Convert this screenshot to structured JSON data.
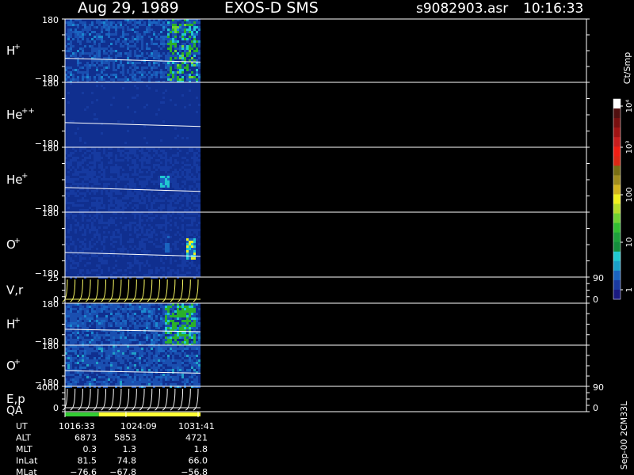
{
  "header": {
    "date": "Aug 29, 1989",
    "mission": "EXOS-D SMS",
    "file": "s9082903.asr",
    "time": "10:16:33"
  },
  "colors": {
    "background": "#000000",
    "spectrogram_base": "#102f8f",
    "axis": "#ffffff",
    "line_traces": "#ffff66",
    "qa_bar_green": "#33cc33",
    "qa_bar_yellow": "#ffff33"
  },
  "colorbar": {
    "label": "Ct/Smp",
    "ticks": [
      "1",
      "10",
      "100",
      "10³",
      "10⁴"
    ],
    "colors": [
      "#1a1a80",
      "#1a3aa0",
      "#1a64c0",
      "#1aa0c8",
      "#20c8d0",
      "#148c3c",
      "#1ea03c",
      "#32be32",
      "#6ed232",
      "#b4dc28",
      "#f0f01e",
      "#d2b41e",
      "#a08c1e",
      "#786e14",
      "#dc2814",
      "#f01e14",
      "#c81e1e",
      "#a01414",
      "#781010",
      "#501010",
      "#ffffff"
    ]
  },
  "panels": [
    {
      "id": "H+",
      "label": "H",
      "sup": "+",
      "ymax": "180",
      "ymin": "−180"
    },
    {
      "id": "He++",
      "label": "He",
      "sup": "++",
      "ymax": "180",
      "ymin": "−180"
    },
    {
      "id": "He+",
      "label": "He",
      "sup": "+",
      "ymax": "180",
      "ymin": "−180"
    },
    {
      "id": "O+",
      "label": "O",
      "sup": "+",
      "ymax": "180",
      "ymin": "−180"
    },
    {
      "id": "Vr",
      "label": "V,r",
      "sup": "",
      "ymax": "25",
      "ymin": "0",
      "right_ticks": [
        "90",
        "0"
      ]
    },
    {
      "id": "H+2",
      "label": "H",
      "sup": "+",
      "ymax": "180",
      "ymin": "−180"
    },
    {
      "id": "O+2",
      "label": "O",
      "sup": "+",
      "ymax": "180",
      "ymin": "−180"
    },
    {
      "id": "Ep",
      "label": "E,p",
      "sup": "",
      "ymax": "4000",
      "ymin": "0",
      "right_ticks": [
        "90",
        "0"
      ]
    }
  ],
  "qa_label": "QA",
  "footer": {
    "rows": [
      {
        "label": "UT",
        "values": [
          "1016:33",
          "1024:09",
          "1031:41"
        ]
      },
      {
        "label": "ALT",
        "values": [
          "6873",
          "5853",
          "4721"
        ]
      },
      {
        "label": "MLT",
        "values": [
          "0.3",
          "1.3",
          "1.8"
        ]
      },
      {
        "label": "InLat",
        "values": [
          "81.5",
          "74.8",
          "66.0"
        ]
      },
      {
        "label": "MLat",
        "values": [
          "−76.6",
          "−67.8",
          "−56.8"
        ]
      }
    ],
    "stamp": "Sep-00 2CM33L"
  },
  "chart_data": {
    "type": "heatmap",
    "title": "Aug 29, 1989   EXOS-D SMS",
    "xlabel": "UT",
    "x_ticks": [
      "1016:33",
      "1024:09",
      "1031:41"
    ],
    "colorbar_label": "Ct/Smp",
    "colorbar_ticks": [
      "1",
      "10",
      "100",
      "10³",
      "10⁴"
    ],
    "panels": [
      "H+",
      "He++",
      "He+",
      "O+",
      "V,r",
      "H+",
      "O+",
      "E,p"
    ],
    "qa_segments": [
      {
        "color": "green",
        "fraction": 0.25
      },
      {
        "color": "yellow",
        "fraction": 0.75
      }
    ]
  }
}
